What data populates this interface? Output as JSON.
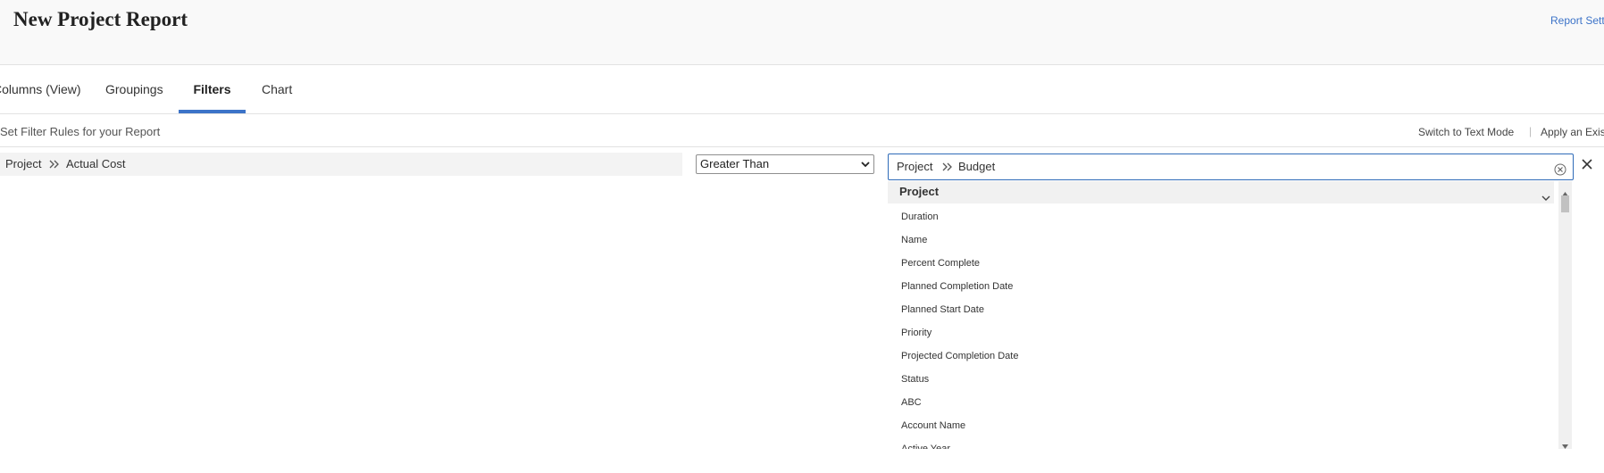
{
  "header": {
    "title": "New Project Report",
    "report_settings_label": "Report Settings"
  },
  "tabs": [
    {
      "label": "Columns (View)"
    },
    {
      "label": "Groupings"
    },
    {
      "label": "Filters"
    },
    {
      "label": "Chart"
    }
  ],
  "filters": {
    "heading": "Set Filter Rules for your Report",
    "switch_mode_label": "Switch to Text Mode",
    "separator": "|",
    "apply_existing_label": "Apply an Existing Filter",
    "rule": {
      "field_object": "Project",
      "field_name": "Actual Cost",
      "operator": "Greater Than",
      "value_object": "Project",
      "value_field": "Budget"
    }
  },
  "dropdown": {
    "group_label": "Project",
    "options": [
      "Duration",
      "Name",
      "Percent Complete",
      "Planned Completion Date",
      "Planned Start Date",
      "Priority",
      "Projected Completion Date",
      "Status",
      "ABC",
      "Account Name",
      "Active Year"
    ]
  },
  "colors": {
    "accent": "#3c73c8",
    "input_border": "#2f6bb8"
  },
  "icons": {
    "breadcrumb_separator": "double-chevron-right-icon",
    "clear": "clear-circle-x-icon",
    "remove": "close-icon",
    "group_toggle": "chevron-down-icon"
  }
}
